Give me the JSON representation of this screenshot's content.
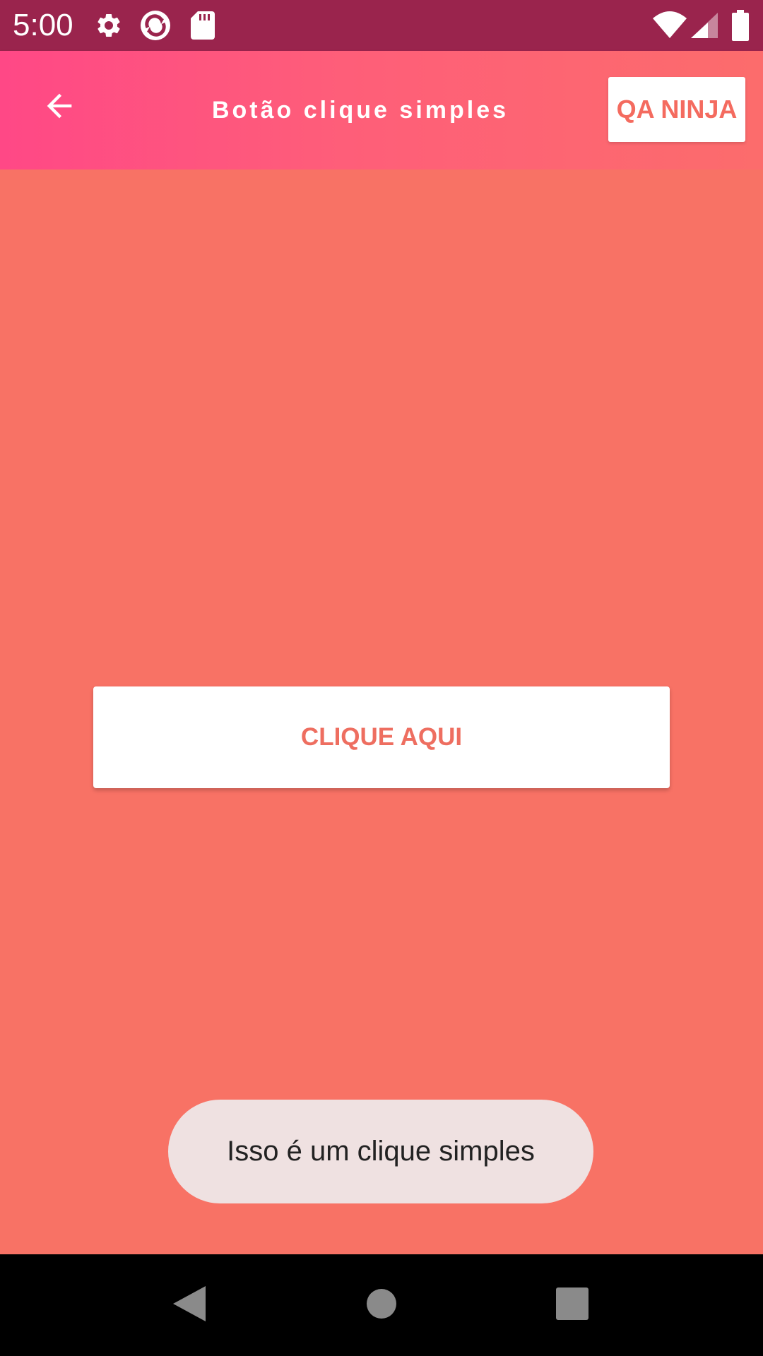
{
  "status_bar": {
    "time": "5:00",
    "icons": [
      "gear-icon",
      "sync-icon",
      "sd-card-icon",
      "wifi-icon",
      "signal-icon",
      "battery-icon"
    ]
  },
  "app_bar": {
    "back_icon": "arrow-left-icon",
    "title": "Botão clique simples",
    "action_label": "QA NINJA"
  },
  "main": {
    "button_label": "CLIQUE AQUI"
  },
  "toast": {
    "message": "Isso é um clique simples"
  },
  "nav_bar": {
    "icons": [
      "back-triangle-icon",
      "home-circle-icon",
      "recents-square-icon"
    ]
  },
  "colors": {
    "status_bar": "#9A244D",
    "app_bar_start": "#FF4886",
    "app_bar_end": "#FC6C6C",
    "background": "#F87265",
    "accent_text": "#F46B5F",
    "toast_bg": "#EFE1E1"
  }
}
